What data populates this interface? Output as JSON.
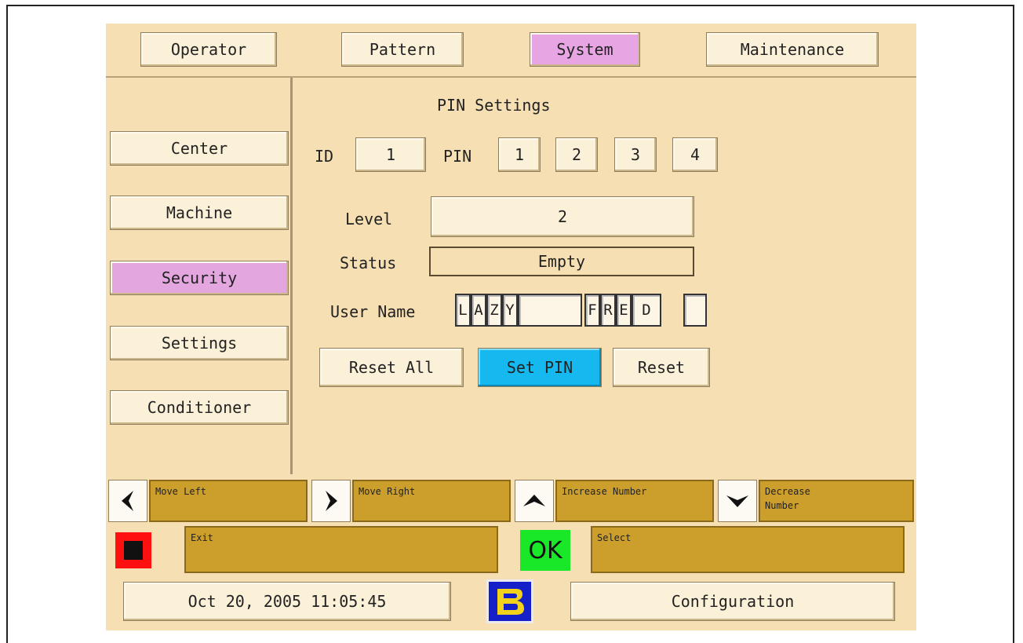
{
  "tabs": [
    {
      "label": "Operator",
      "active": false
    },
    {
      "label": "Pattern",
      "active": false
    },
    {
      "label": "System",
      "active": true
    },
    {
      "label": "Maintenance",
      "active": false
    }
  ],
  "sidebar": {
    "items": [
      {
        "label": "Center",
        "active": false
      },
      {
        "label": "Machine",
        "active": false
      },
      {
        "label": "Security",
        "active": true
      },
      {
        "label": "Settings",
        "active": false
      },
      {
        "label": "Conditioner",
        "active": false
      }
    ]
  },
  "pin_settings": {
    "title": "PIN Settings",
    "id_label": "ID",
    "id_value": "1",
    "pin_label": "PIN",
    "pin_digits": [
      "1",
      "2",
      "3",
      "4"
    ],
    "level_label": "Level",
    "level_value": "2",
    "status_label": "Status",
    "status_value": "Empty",
    "username_label": "User Name",
    "username_chars": [
      "L",
      "A",
      "Z",
      "Y",
      "",
      "F",
      "R",
      "E",
      "D",
      ""
    ],
    "buttons": {
      "reset_all": "Reset All",
      "set_pin": "Set PIN",
      "reset": "Reset"
    }
  },
  "hints": {
    "move_left": "Move Left",
    "move_right": "Move Right",
    "increase": "Increase Number",
    "decrease_line1": "Decrease",
    "decrease_line2": "Number",
    "exit": "Exit",
    "ok": "OK",
    "select": "Select"
  },
  "footer": {
    "datetime": "Oct 20, 2005 11:05:45",
    "configuration": "Configuration"
  },
  "colors": {
    "background": "#f6dfb3",
    "active_tab": "#e7a6e3",
    "set_pin": "#15b8ef",
    "hint_box": "#cc9f2c",
    "stop": "#ff1010",
    "ok": "#18e828",
    "logo": "#1620c8"
  }
}
